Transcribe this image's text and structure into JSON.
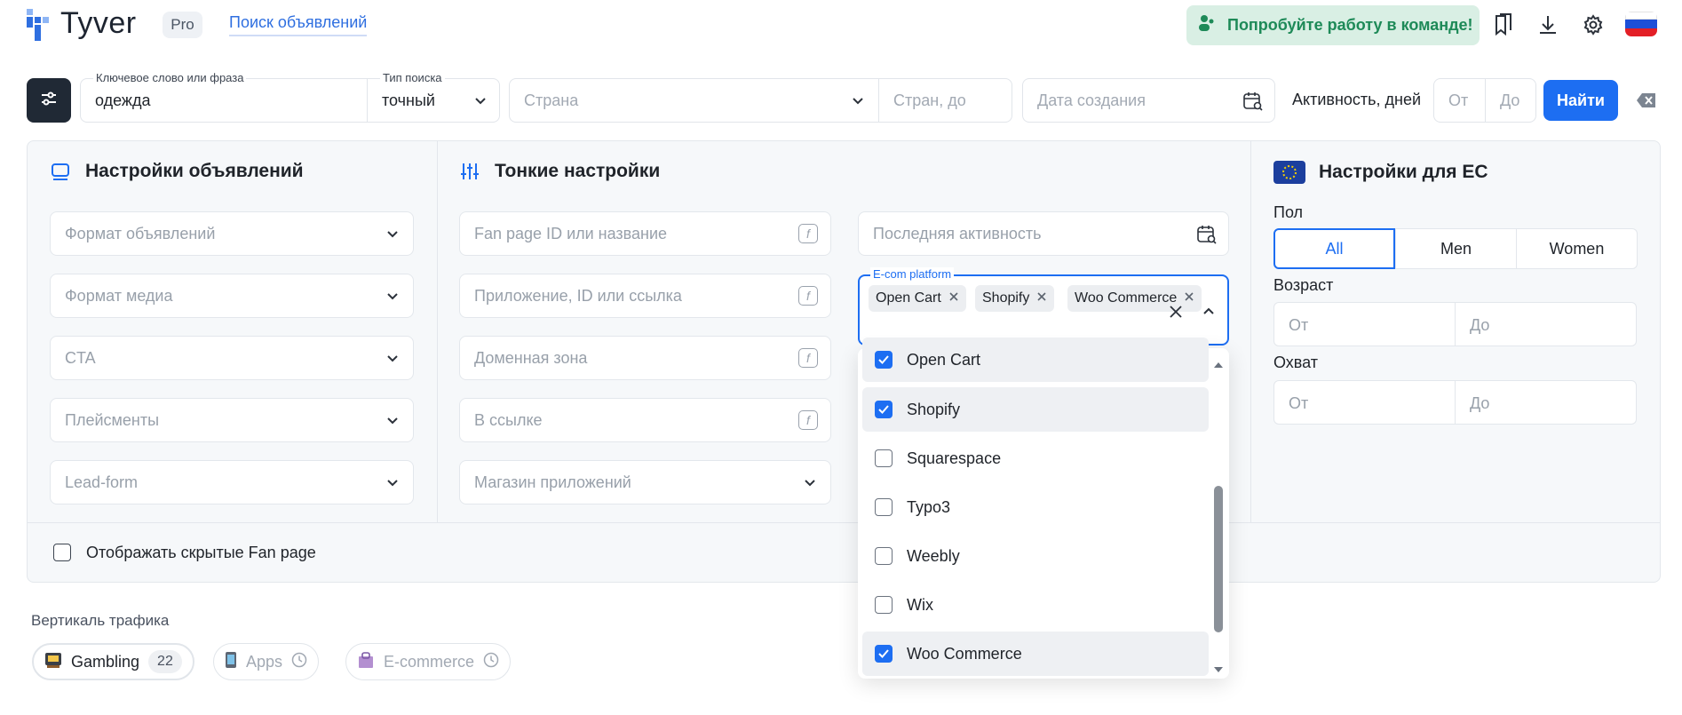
{
  "header": {
    "logo_text": "Tyver",
    "plan_badge": "Pro",
    "nav_link": "Поиск объявлений",
    "team_button": "Попробуйте работу в команде!"
  },
  "search": {
    "keyword_label": "Ключевое слово или фраза",
    "keyword_value": "одежда",
    "type_label": "Тип поиска",
    "type_value": "точный",
    "country_placeholder": "Страна",
    "country_to_placeholder": "Стран, до",
    "created_placeholder": "Дата создания",
    "activity_label": "Активность, дней",
    "activity_from": "От",
    "activity_to": "До",
    "find_button": "Найти"
  },
  "ad_settings": {
    "title": "Настройки объявлений",
    "fields": [
      "Формат объявлений",
      "Формат медиа",
      "CTA",
      "Плейсменты",
      "Lead-form"
    ]
  },
  "fine_settings": {
    "title": "Тонкие настройки",
    "fields": [
      "Fan page ID или название",
      "Приложение, ID или ссылка",
      "Доменная зона",
      "В ссылке"
    ],
    "app_store": "Магазин приложений",
    "last_activity": "Последняя активность",
    "ecom_label": "E-com platform",
    "ecom_chips": [
      "Open Cart",
      "Shopify",
      "Woo Commerce"
    ],
    "ecom_options": [
      {
        "label": "Open Cart",
        "checked": true
      },
      {
        "label": "Shopify",
        "checked": true
      },
      {
        "label": "Squarespace",
        "checked": false
      },
      {
        "label": "Typo3",
        "checked": false
      },
      {
        "label": "Weebly",
        "checked": false
      },
      {
        "label": "Wix",
        "checked": false
      },
      {
        "label": "Woo Commerce",
        "checked": true
      }
    ]
  },
  "eu_settings": {
    "title": "Настройки для ЕС",
    "gender_label": "Пол",
    "gender_options": [
      "All",
      "Men",
      "Women"
    ],
    "gender_selected": "All",
    "age_label": "Возраст",
    "age_from": "От",
    "age_to": "До",
    "reach_label": "Охват",
    "reach_from": "От",
    "reach_to": "До"
  },
  "hidden_fan_page": "Отображать скрытые Fan page",
  "traffic": {
    "label": "Вертикаль трафика",
    "chips": [
      {
        "label": "Gambling",
        "count": "22"
      },
      {
        "label": "Apps"
      },
      {
        "label": "E-commerce"
      }
    ]
  },
  "colors": {
    "accent": "#1d6ef2",
    "success": "#1e8a58",
    "dark": "#202935"
  }
}
